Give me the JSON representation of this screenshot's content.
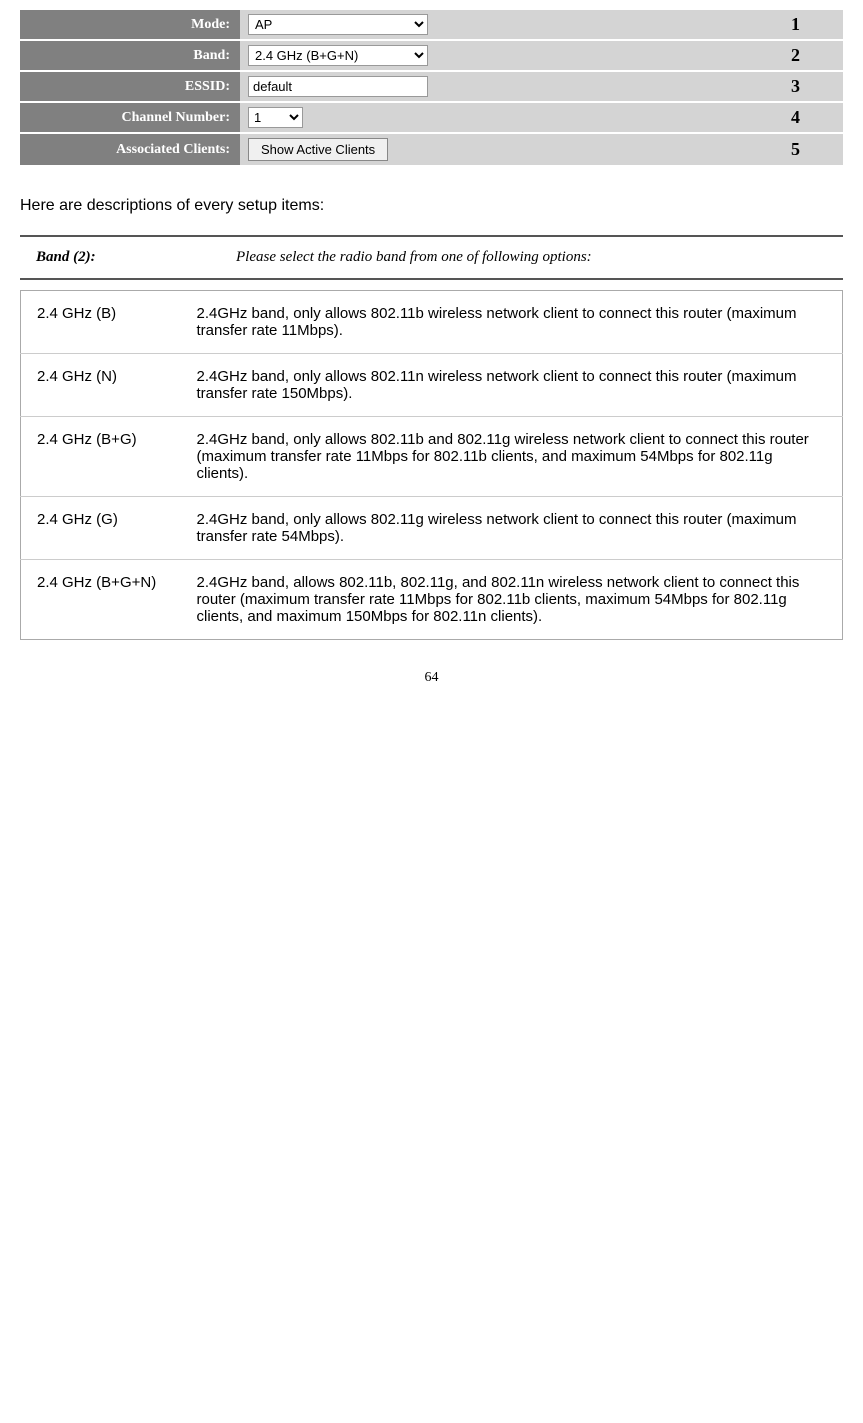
{
  "form": {
    "rows": [
      {
        "label": "Mode:",
        "type": "select",
        "options": [
          "AP"
        ],
        "value": "AP",
        "number": "1"
      },
      {
        "label": "Band:",
        "type": "select",
        "options": [
          "2.4 GHz (B+G+N)"
        ],
        "value": "2.4 GHz (B+G+N)",
        "number": "2"
      },
      {
        "label": "ESSID:",
        "type": "text",
        "value": "default",
        "number": "3"
      },
      {
        "label": "Channel Number:",
        "type": "select-small",
        "options": [
          "1"
        ],
        "value": "1",
        "number": "4"
      },
      {
        "label": "Associated Clients:",
        "type": "button",
        "button_label": "Show Active Clients",
        "number": "5"
      }
    ]
  },
  "description_heading": "Here are descriptions of every setup items:",
  "band_section": {
    "term": "Band (2):",
    "definition": "Please select the radio band from one of following options:"
  },
  "band_options": [
    {
      "name": "2.4 GHz (B)",
      "desc": "2.4GHz band, only allows 802.11b wireless network client to connect this router (maximum transfer rate 11Mbps)."
    },
    {
      "name": "2.4 GHz (N)",
      "desc": "2.4GHz band, only allows 802.11n wireless network client to connect this router (maximum transfer rate 150Mbps)."
    },
    {
      "name": "2.4 GHz (B+G)",
      "desc": "2.4GHz band, only allows 802.11b and 802.11g wireless network client to connect this router (maximum transfer rate 11Mbps for 802.11b clients, and maximum 54Mbps for 802.11g clients)."
    },
    {
      "name": "2.4 GHz (G)",
      "desc": "2.4GHz band, only allows 802.11g wireless network client to connect this router (maximum transfer rate 54Mbps)."
    },
    {
      "name": "2.4 GHz (B+G+N)",
      "desc": "2.4GHz band, allows 802.11b, 802.11g, and 802.11n wireless network client to connect this router (maximum transfer rate 11Mbps for 802.11b clients, maximum 54Mbps for 802.11g clients, and maximum 150Mbps for 802.11n clients)."
    }
  ],
  "page_number": "64"
}
